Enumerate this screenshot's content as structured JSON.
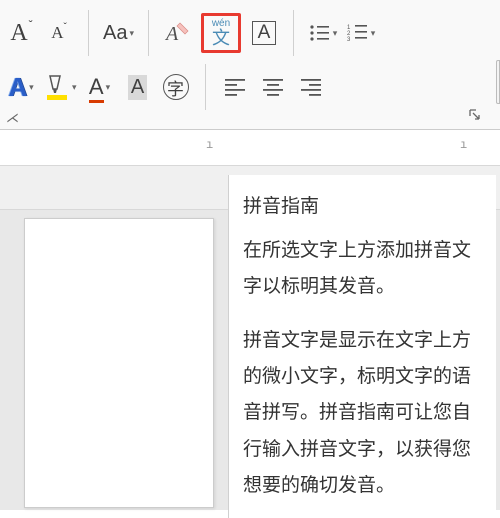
{
  "ribbon": {
    "grow_font": "A",
    "grow_sup": "ˇ",
    "shrink_font": "A",
    "shrink_sup": "ˇ",
    "change_case": "Aa",
    "clear_format": "A",
    "phonetic_top": "wén",
    "phonetic_bottom": "文",
    "char_border": "A",
    "text_effects": "A",
    "highlight": "ab",
    "font_color": "A",
    "char_shade": "A",
    "enclose": "字"
  },
  "tooltip": {
    "title": "拼音指南",
    "p1": "在所选文字上方添加拼音文字以标明其发音。",
    "p2": "拼音文字是显示在文字上方的微小文字，标明文字的语音拼写。拼音指南可让您自行输入拼音文字，以获得您想要的确切发音。"
  },
  "ruler": {
    "t1": "ı",
    "t2": "ı"
  }
}
